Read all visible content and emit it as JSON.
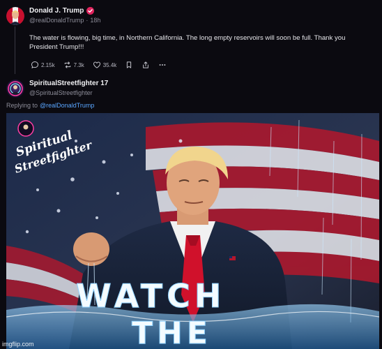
{
  "original_post": {
    "author_name": "Donald J. Trump",
    "handle": "@realDonaldTrump",
    "separator": "·",
    "time": "18h",
    "text": "The water is flowing, big time, in Northern California. The long empty reservoirs will soon be full. Thank you President Trump!!!",
    "stats": {
      "replies": "2.15k",
      "retruths": "7.3k",
      "likes": "35.4k"
    },
    "icons": [
      "reply-icon",
      "retruth-icon",
      "heart-icon",
      "bookmark-icon",
      "share-icon",
      "more-icon"
    ]
  },
  "reply_post": {
    "author_name": "SpiritualStreetfighter 17",
    "handle": "@SpiritualStreetfighter",
    "replying_to_label": "Replying to",
    "replying_to_handle": "@realDonaldTrump",
    "image": {
      "overlay_text_line1": "WATCH",
      "overlay_text_line2": "THE",
      "logo_text_line1": "Spiritual",
      "logo_text_line2": "Streetfighter"
    }
  },
  "watermark": "imgflip.com",
  "colors": {
    "background": "#0b0a10",
    "link": "#5aa6ff",
    "verified_badge": "#e0245e",
    "muted_text": "#8d8d99"
  }
}
